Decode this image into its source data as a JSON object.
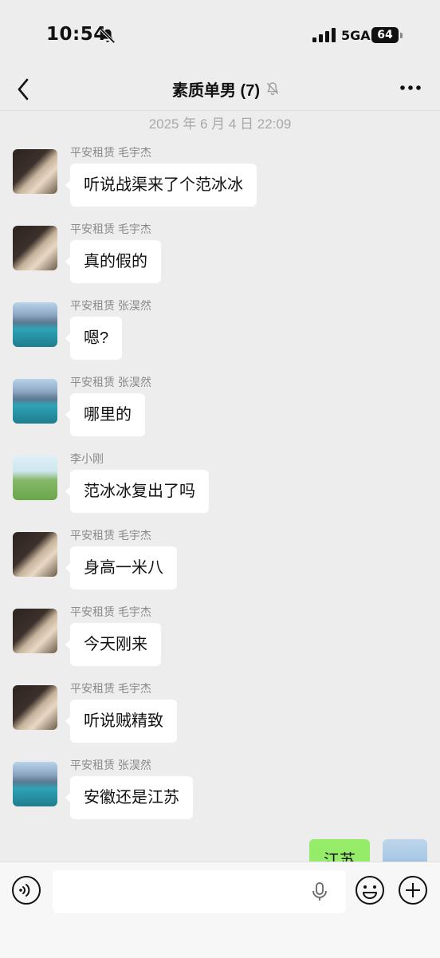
{
  "status_bar": {
    "time": "10:54",
    "network": "5GA",
    "battery": "64"
  },
  "header": {
    "title": "素质单男 (7)"
  },
  "timestamp": "2025 年 6 月 4 日  22:09",
  "messages": [
    {
      "sender": "平安租赁 毛宇杰",
      "text": "听说战渠来了个范冰冰",
      "avatar": "room-photo"
    },
    {
      "sender": "平安租赁 毛宇杰",
      "text": "真的假的",
      "avatar": "room-photo"
    },
    {
      "sender": "平安租赁 张淏然",
      "text": "嗯?",
      "avatar": "lake-photo"
    },
    {
      "sender": "平安租赁 张淏然",
      "text": "哪里的",
      "avatar": "lake-photo"
    },
    {
      "sender": "李小刚",
      "text": "范冰冰复出了吗",
      "avatar": "field-photo"
    },
    {
      "sender": "平安租赁 毛宇杰",
      "text": "身高一米八",
      "avatar": "room-photo"
    },
    {
      "sender": "平安租赁 毛宇杰",
      "text": "今天刚来",
      "avatar": "room-photo"
    },
    {
      "sender": "平安租赁 毛宇杰",
      "text": "听说贼精致",
      "avatar": "room-photo"
    },
    {
      "sender": "平安租赁 张淏然",
      "text": "安徽还是江苏",
      "avatar": "lake-photo"
    }
  ],
  "outgoing": {
    "text": "江苏"
  },
  "input_bar": {
    "placeholder": ""
  },
  "colors": {
    "background": "#ededed",
    "outgoing_bubble": "#95ec69",
    "incoming_bubble": "#ffffff"
  }
}
